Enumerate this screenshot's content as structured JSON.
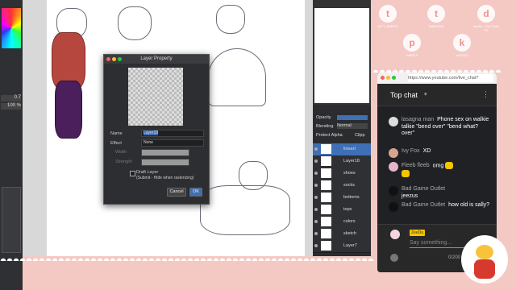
{
  "left_panel": {
    "opacity_value": "0.7",
    "percent_value": "100 %"
  },
  "dialog": {
    "title": "Layer Property",
    "name_label": "Name",
    "name_value": "Layer18",
    "effect_label": "Effect",
    "effect_value": "None",
    "width_label": "Width",
    "strength_label": "Strength",
    "draft_label": "Draft Layer",
    "draft_note": "(Submit - Hide when rasterizing)",
    "cancel_label": "Cancel",
    "ok_label": "OK"
  },
  "layer_panel": {
    "opacity_label": "Opacity",
    "blending_label": "Blending",
    "blending_value": "Normal",
    "protect_alpha_label": "Protect Alpha",
    "clipping_label": "Clipp",
    "layers": [
      "lineart",
      "Layer18",
      "shoes",
      "socks",
      "bottoms",
      "tops",
      "colors",
      "sketch",
      "Layer7"
    ]
  },
  "social": {
    "twitter_handle": "@YT_kaffi213",
    "tumblr_handle": "kaffei0615",
    "discord_label": "media - The Trash Pit",
    "patreon_handle": "kaffi213",
    "ko_fi_handle": "kf12213"
  },
  "chat": {
    "url": "https://www.youtube.com/live_chat?",
    "header_title": "Top chat",
    "messages": [
      {
        "author": "lasagna man",
        "text": "Phone sex on walkie talkie \"bend over\" \"bend what? over\""
      },
      {
        "author": "Ivy Fox",
        "text": "XD"
      },
      {
        "author": "Fleeb fleeb",
        "text": "omg"
      },
      {
        "author": "Bad Game Outlet",
        "text": "jeezus"
      },
      {
        "author": "Bad Game Outlet",
        "text": "how old is sally?"
      }
    ],
    "input_user_badge": "ZeeDu",
    "input_placeholder": "Say something...",
    "char_count": "0/200"
  },
  "colors": {
    "background_pink": "#f4c9c4",
    "chat_bg": "#202124",
    "selected_layer": "#3f6fb4",
    "accent_icon": "#f08c86"
  }
}
